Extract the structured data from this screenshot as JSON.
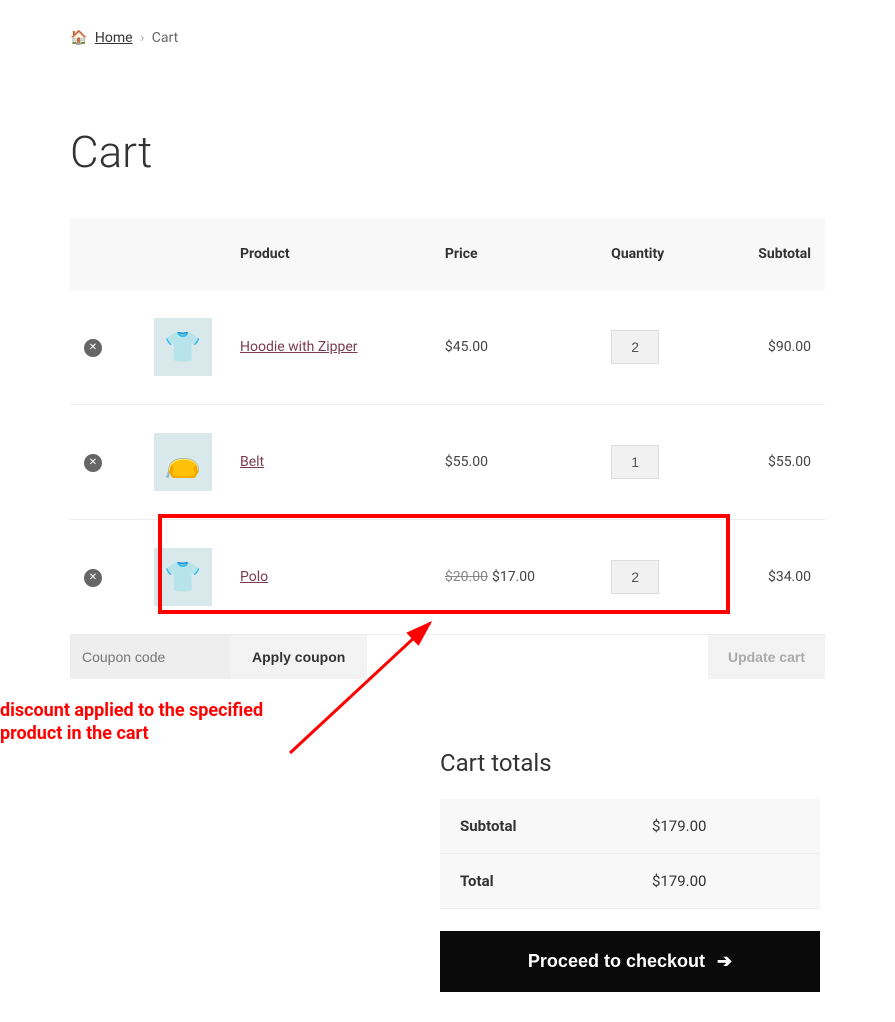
{
  "breadcrumb": {
    "home": "Home",
    "current": "Cart"
  },
  "page_title": "Cart",
  "headers": {
    "product": "Product",
    "price": "Price",
    "quantity": "Quantity",
    "subtotal": "Subtotal"
  },
  "items": [
    {
      "name": "Hoodie with Zipper",
      "price": "$45.00",
      "quantity": "2",
      "subtotal": "$90.00",
      "icon": "👕"
    },
    {
      "name": "Belt",
      "price": "$55.00",
      "quantity": "1",
      "subtotal": "$55.00",
      "icon": "👝"
    },
    {
      "name": "Polo",
      "price_original": "$20.00",
      "price": "$17.00",
      "quantity": "2",
      "subtotal": "$34.00",
      "icon": "👕"
    }
  ],
  "coupon": {
    "placeholder": "Coupon code",
    "apply": "Apply coupon",
    "update": "Update cart"
  },
  "annotation": "discount applied to the specified product in the cart",
  "totals": {
    "heading": "Cart totals",
    "subtotal_label": "Subtotal",
    "subtotal_value": "$179.00",
    "total_label": "Total",
    "total_value": "$179.00"
  },
  "checkout": "Proceed to checkout"
}
